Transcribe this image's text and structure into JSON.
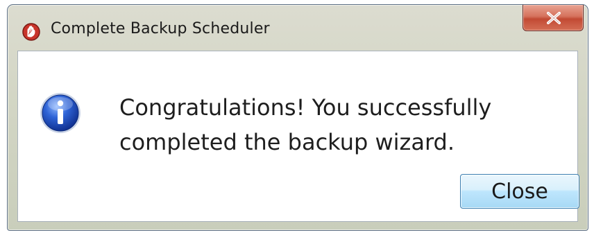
{
  "window": {
    "title": "Complete Backup Scheduler",
    "app_icon": "backup-scheduler-app-icon",
    "close_icon": "close-x-icon"
  },
  "dialog": {
    "icon": "information-icon",
    "message_lines": [
      "Congratulations! You successfully",
      "completed the backup wizard."
    ],
    "close_button_label": "Close"
  },
  "colors": {
    "title_close_button": "#c8503a",
    "info_icon_blue": "#1e4fbf",
    "button_border": "#3c7fb1"
  }
}
